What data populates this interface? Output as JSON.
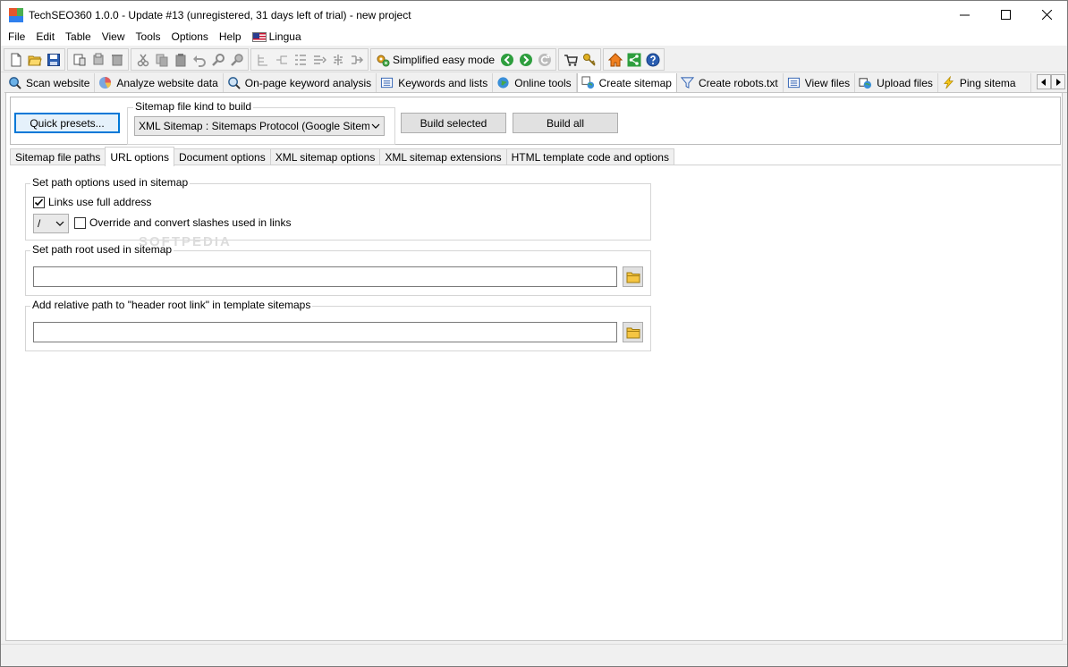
{
  "window": {
    "title": "TechSEO360 1.0.0 - Update #13 (unregistered, 31 days left of trial) - new project"
  },
  "menu": {
    "items": [
      "File",
      "Edit",
      "Table",
      "View",
      "Tools",
      "Options",
      "Help"
    ],
    "lingua": "Lingua"
  },
  "toolbar": {
    "mode_label": "Simplified easy mode"
  },
  "main_tabs": [
    {
      "label": "Scan website",
      "icon": "magnifier-globe-icon"
    },
    {
      "label": "Analyze website data",
      "icon": "pie-chart-icon"
    },
    {
      "label": "On-page keyword analysis",
      "icon": "magnifier-icon"
    },
    {
      "label": "Keywords and lists",
      "icon": "list-icon"
    },
    {
      "label": "Online tools",
      "icon": "globe-icon"
    },
    {
      "label": "Create sitemap",
      "icon": "sitemap-icon",
      "active": true
    },
    {
      "label": "Create robots.txt",
      "icon": "filter-icon"
    },
    {
      "label": "View files",
      "icon": "list-icon"
    },
    {
      "label": "Upload files",
      "icon": "upload-globe-icon"
    },
    {
      "label": "Ping sitema",
      "icon": "lightning-icon"
    }
  ],
  "top_panel": {
    "quick_presets_label": "Quick presets...",
    "sitemap_kind_legend": "Sitemap file kind to build",
    "sitemap_kind_value": "XML Sitemap : Sitemaps Protocol (Google Sitemaps)",
    "build_selected_label": "Build selected",
    "build_all_label": "Build all"
  },
  "sub_tabs": [
    {
      "label": "Sitemap file paths"
    },
    {
      "label": "URL options",
      "active": true
    },
    {
      "label": "Document options"
    },
    {
      "label": "XML sitemap options"
    },
    {
      "label": "XML sitemap extensions"
    },
    {
      "label": "HTML template code and options"
    }
  ],
  "url_options": {
    "path_options_legend": "Set path options used in sitemap",
    "links_full_address_label": "Links use full address",
    "links_full_address_checked": true,
    "slash_value": "/",
    "override_slashes_label": "Override and convert slashes used in links",
    "override_slashes_checked": false,
    "path_root_legend": "Set path root used in sitemap",
    "path_root_value": "",
    "relative_path_legend": "Add relative path to \"header root link\" in template sitemaps",
    "relative_path_value": ""
  },
  "watermark": "SOFTPEDIA",
  "colors": {
    "accent": "#0078d7",
    "window_bg": "#f0f0f0",
    "panel_bg": "#ffffff"
  }
}
